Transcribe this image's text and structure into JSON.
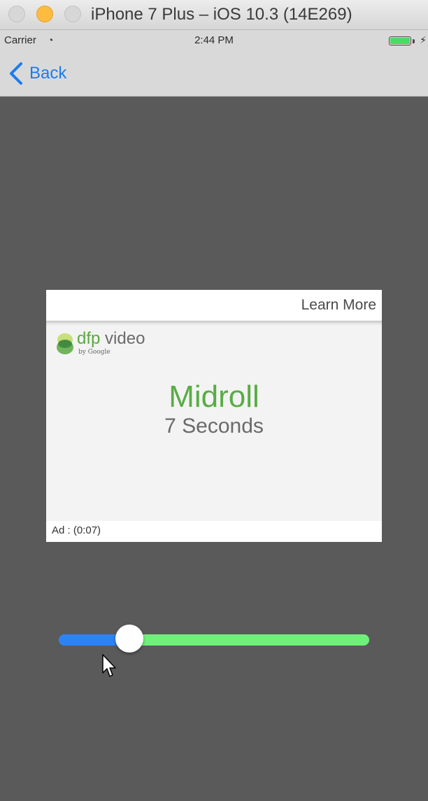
{
  "window": {
    "title": "iPhone 7 Plus – iOS 10.3 (14E269)"
  },
  "status_bar": {
    "carrier": "Carrier",
    "wifi_icon": "wifi-icon",
    "time": "2:44 PM",
    "battery_icon": "battery-icon",
    "battery_level": 1.0,
    "charging_icon": "charging-bolt-icon"
  },
  "nav": {
    "back_label": "Back",
    "back_icon": "chevron-left-icon",
    "accent_color": "#1a7cf0"
  },
  "ad": {
    "learn_more": "Learn More",
    "logo_dfp": "dfp",
    "logo_video": "video",
    "logo_by": "by Google",
    "title": "Midroll",
    "subtitle": "7 Seconds",
    "countdown": "Ad : (0:07)",
    "brand_color": "#59ac44"
  },
  "slider": {
    "value": 0.2,
    "min_track_color": "#2c83f5",
    "max_track_color": "#6ff07a"
  }
}
